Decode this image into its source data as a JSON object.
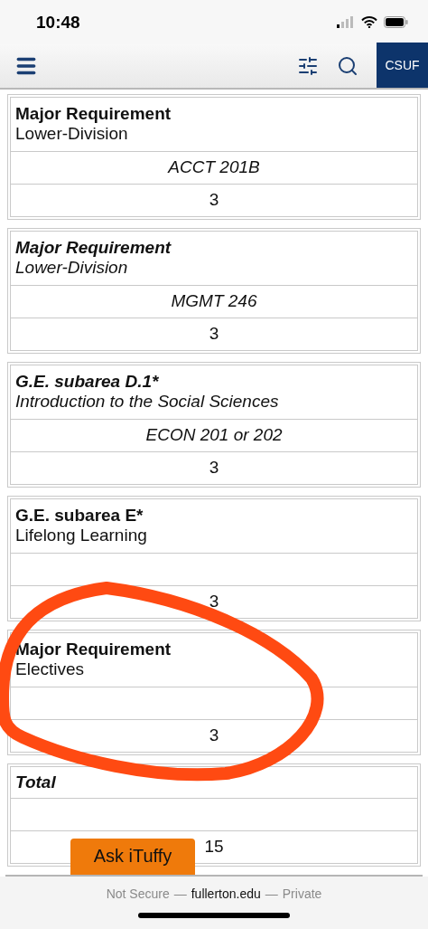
{
  "status_bar": {
    "time": "10:48"
  },
  "nav": {
    "brand": "CSUF"
  },
  "requirements": [
    {
      "title": "Major Requirement",
      "subtitle": "Lower-Division",
      "course": "ACCT 201B",
      "units": "3",
      "italic": false
    },
    {
      "title": "Major Requirement",
      "subtitle": "Lower-Division",
      "course": "MGMT 246",
      "units": "3",
      "italic": true
    },
    {
      "title": "G.E. subarea D.1*",
      "subtitle": "Introduction to the Social Sciences",
      "course": "ECON 201 or 202",
      "units": "3",
      "italic": true
    },
    {
      "title": "G.E. subarea E*",
      "subtitle": "Lifelong Learning",
      "units": "3",
      "italic": false
    },
    {
      "title": "Major Requirement",
      "subtitle": "Electives",
      "units": "3",
      "italic": false
    },
    {
      "title": "Total",
      "units": "15",
      "italic": true
    }
  ],
  "ask_button": {
    "label": "Ask iTuffy"
  },
  "address_bar": [
    {
      "text": "Not Secure",
      "emphasis": false
    },
    {
      "text": "—",
      "emphasis": false
    },
    {
      "text": "fullerton.edu",
      "emphasis": true
    },
    {
      "text": "—",
      "emphasis": false
    },
    {
      "text": "Private",
      "emphasis": false
    }
  ]
}
